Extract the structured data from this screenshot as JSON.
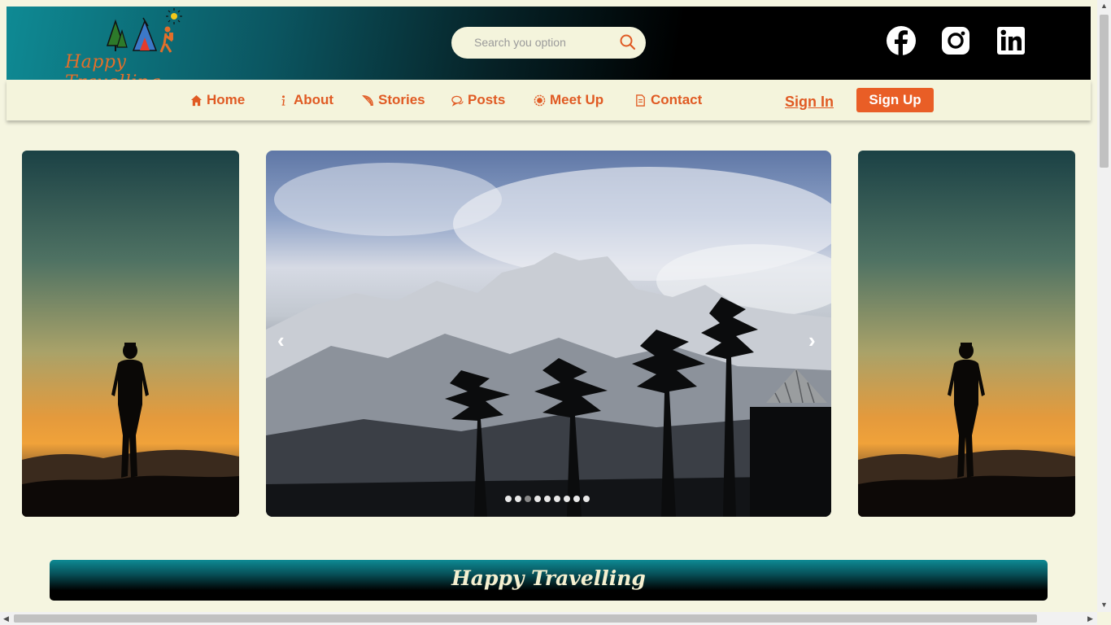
{
  "header": {
    "logo_text": "Happy Travelling",
    "search_placeholder": "Search you option",
    "social": [
      "facebook-icon",
      "instagram-icon",
      "linkedin-icon"
    ]
  },
  "nav": {
    "items": [
      {
        "label": "Home",
        "icon": "home-icon"
      },
      {
        "label": "About",
        "icon": "info-icon"
      },
      {
        "label": "Stories",
        "icon": "feather-icon"
      },
      {
        "label": "Posts",
        "icon": "chat-icon"
      },
      {
        "label": "Meet Up",
        "icon": "badge-icon"
      },
      {
        "label": "Contact",
        "icon": "document-icon"
      }
    ],
    "sign_in": "Sign In",
    "sign_up": "Sign Up"
  },
  "carousel": {
    "prev": "‹",
    "next": "›",
    "slide_count": 9,
    "active_index": 2
  },
  "banner": {
    "title": "Happy Travelling"
  },
  "colors": {
    "accent": "#e05a23",
    "page_bg": "#f5f5e0",
    "teal": "#0e8a94"
  }
}
